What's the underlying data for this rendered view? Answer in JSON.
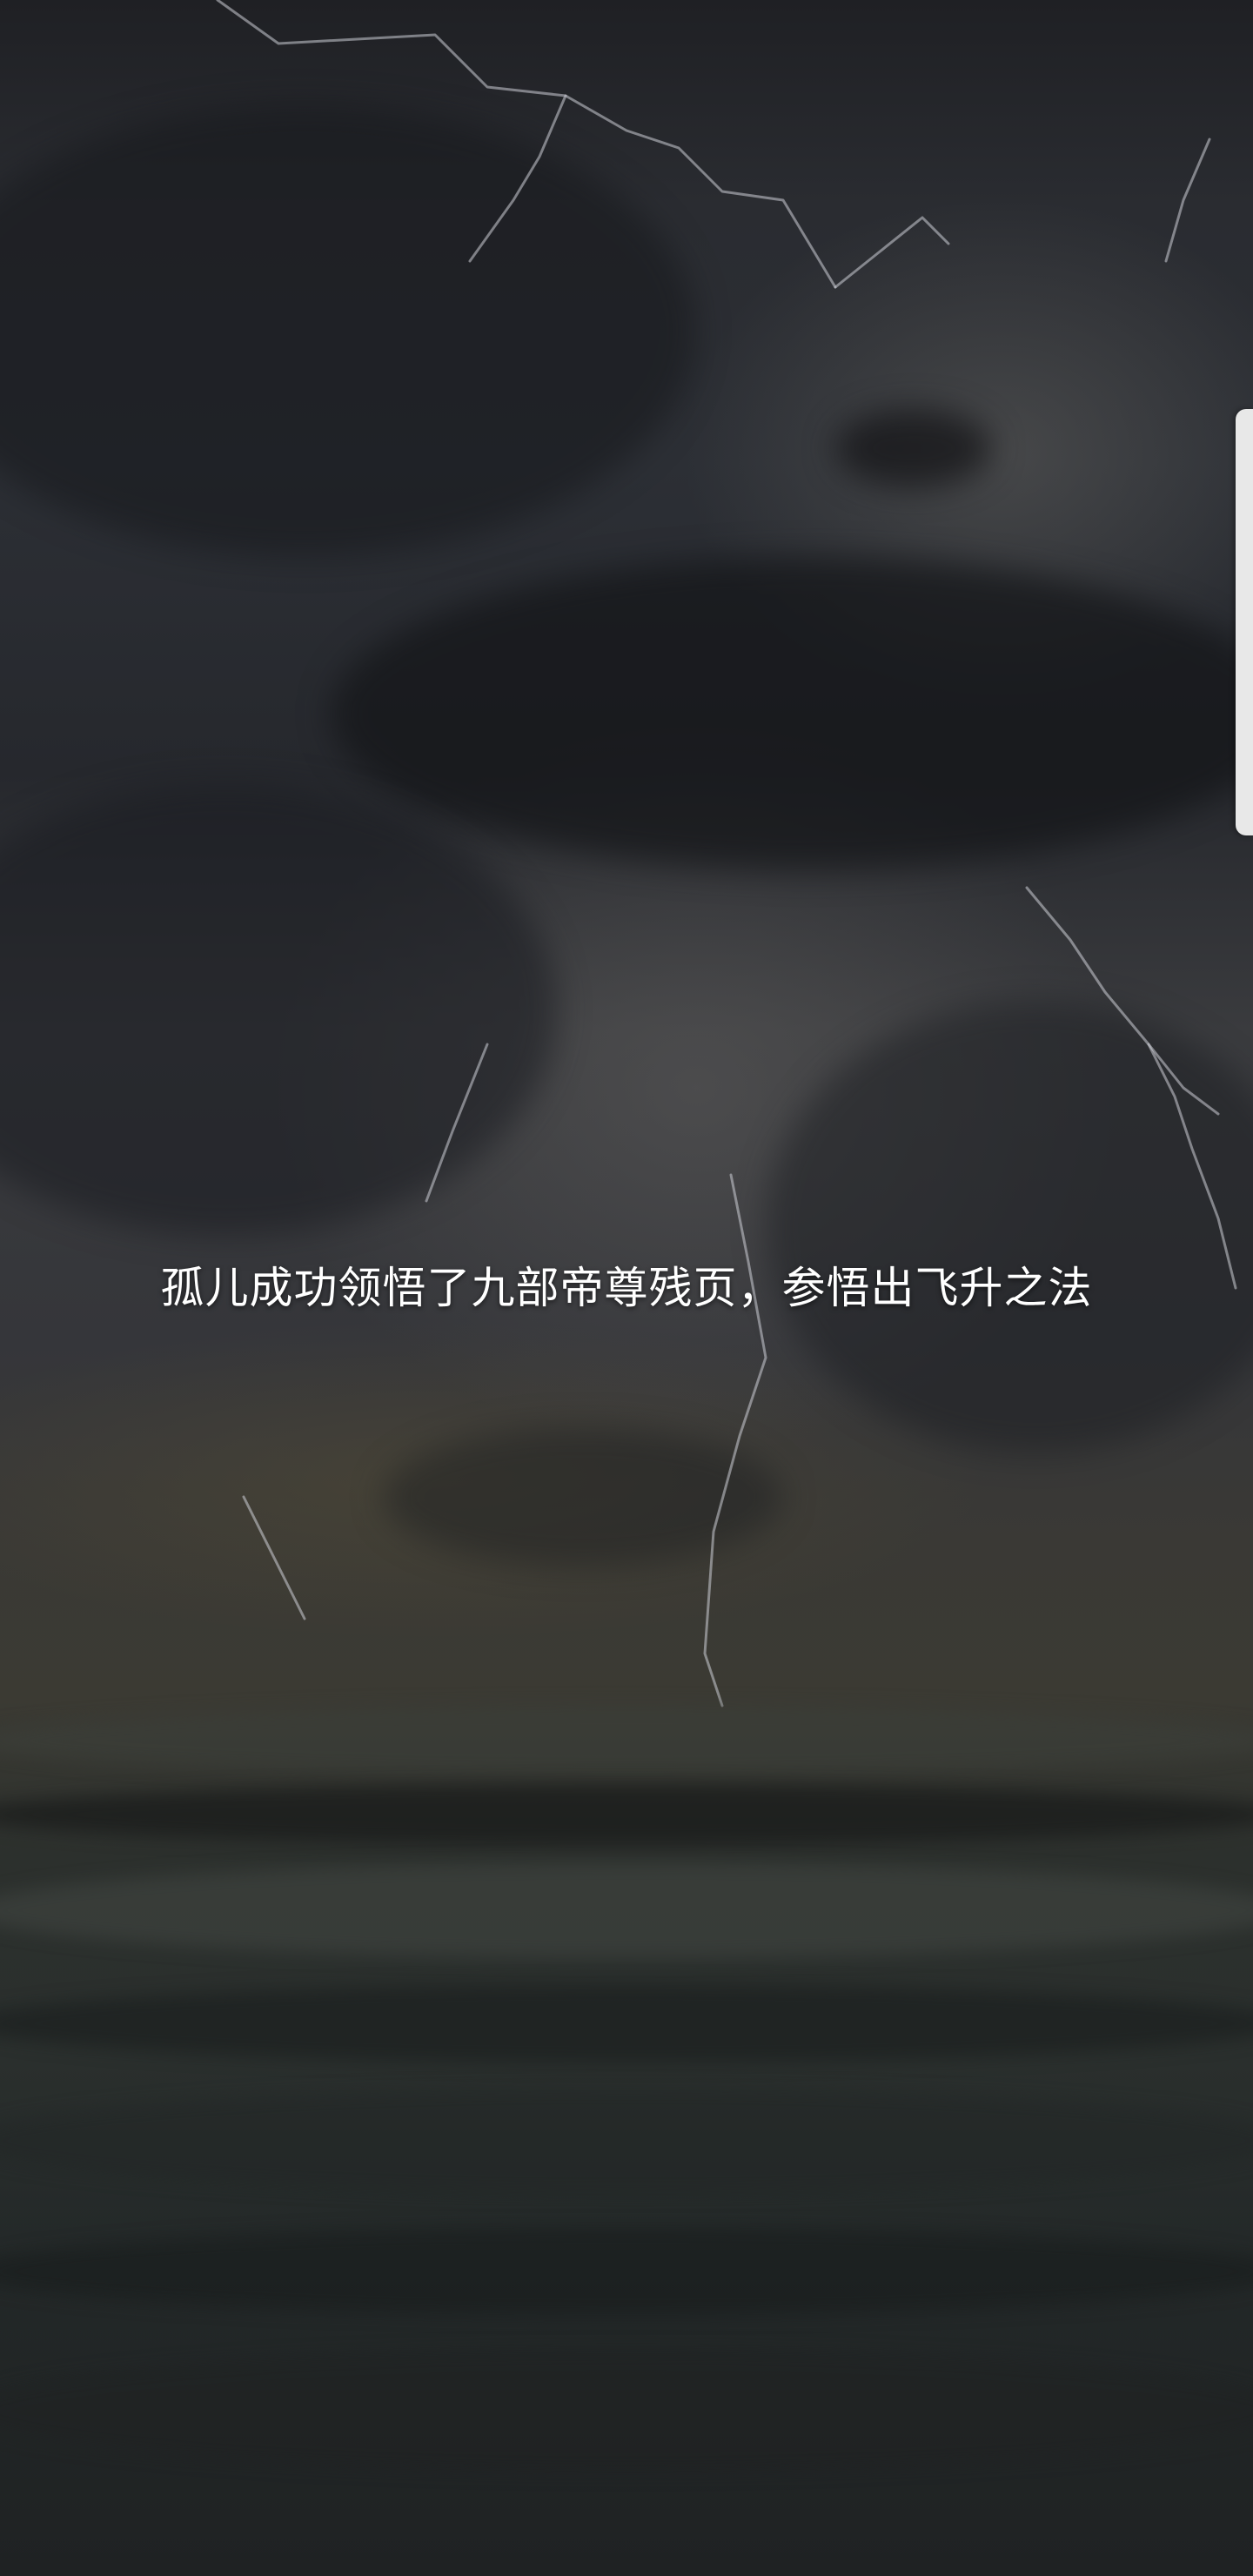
{
  "story": {
    "caption": "孤儿成功领悟了九部帝尊残页，参悟出飞升之法"
  },
  "colors": {
    "caption_text": "#ffffff",
    "sky_dark": "#1f2024",
    "sea": "#232828",
    "handle": "#e8e8e8"
  }
}
